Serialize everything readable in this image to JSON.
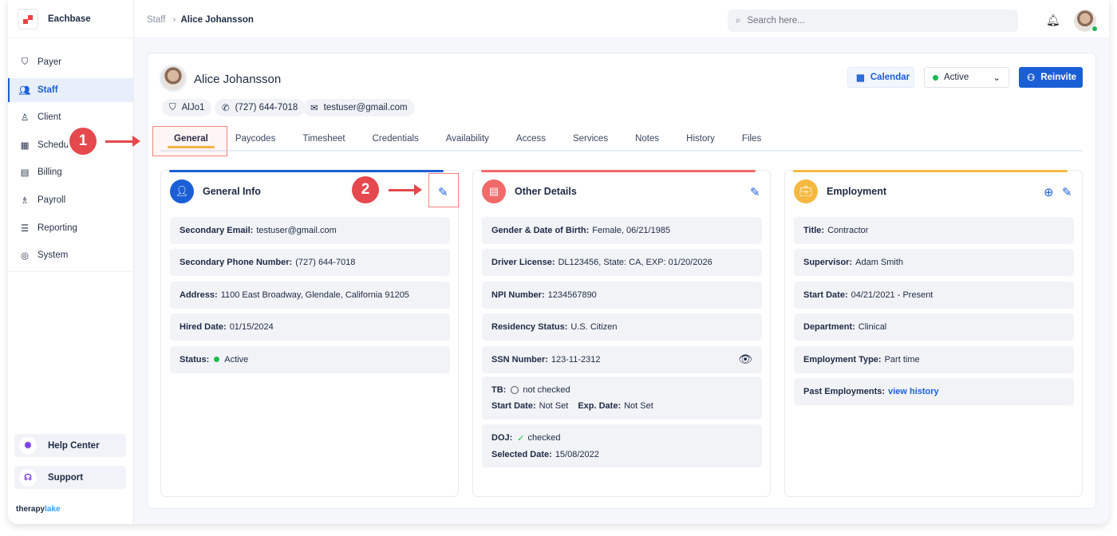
{
  "app": {
    "name": "Eachbase",
    "brand_left": "therapy",
    "brand_right": "lake"
  },
  "sidebar": {
    "items": [
      {
        "label": "Payer",
        "icon": "shield-icon"
      },
      {
        "label": "Staff",
        "icon": "users-icon",
        "active": true
      },
      {
        "label": "Client",
        "icon": "client-icon"
      },
      {
        "label": "Schedule",
        "icon": "calendar-icon"
      },
      {
        "label": "Billing",
        "icon": "billing-icon"
      },
      {
        "label": "Payroll",
        "icon": "payroll-icon"
      },
      {
        "label": "Reporting",
        "icon": "report-icon"
      },
      {
        "label": "System",
        "icon": "system-icon"
      }
    ],
    "help": "Help Center",
    "support": "Support"
  },
  "header": {
    "breadcrumb": [
      "Staff",
      "Alice Johansson"
    ],
    "search_placeholder": "Search here..."
  },
  "profile": {
    "name": "Alice Johansson",
    "id": "AlJo1",
    "phone": "(727) 644-7018",
    "email": "testuser@gmail.com",
    "calendar_label": "Calendar",
    "status": "Active",
    "reinvite_label": "Reinvite"
  },
  "tabs": [
    "General",
    "Paycodes",
    "Timesheet",
    "Credentials",
    "Availability",
    "Access",
    "Services",
    "Notes",
    "History",
    "Files"
  ],
  "general": {
    "title": "General Info",
    "rows": [
      {
        "k": "Secondary Email:",
        "v": "testuser@gmail.com"
      },
      {
        "k": "Secondary Phone Number:",
        "v": "(727) 644-7018"
      },
      {
        "k": "Address:",
        "v": "1100 East Broadway, Glendale, California 91205"
      },
      {
        "k": "Hired Date:",
        "v": "01/15/2024"
      },
      {
        "k": "Status:",
        "v": "Active"
      }
    ]
  },
  "other": {
    "title": "Other Details",
    "rows": [
      {
        "k": "Gender & Date of Birth:",
        "v": "Female, 06/21/1985"
      },
      {
        "k": "Driver License:",
        "v": "DL123456, State: CA, EXP: 01/20/2026"
      },
      {
        "k": "NPI Number:",
        "v": "1234567890"
      },
      {
        "k": "Residency Status:",
        "v": "U.S. Citizen"
      },
      {
        "k": "SSN Number:",
        "v": "123-11-2312"
      }
    ],
    "tb": {
      "k": "TB:",
      "v": "not checked",
      "start_k": "Start Date:",
      "start_v": "Not Set",
      "exp_k": "Exp. Date:",
      "exp_v": "Not Set"
    },
    "doj": {
      "k": "DOJ:",
      "v": "checked",
      "date_k": "Selected Date:",
      "date_v": "15/08/2022"
    }
  },
  "employment": {
    "title": "Employment",
    "rows": [
      {
        "k": "Title:",
        "v": "Contractor"
      },
      {
        "k": "Supervisor:",
        "v": "Adam Smith"
      },
      {
        "k": "Start Date:",
        "v": "04/21/2021 - Present"
      },
      {
        "k": "Department:",
        "v": "Clinical"
      },
      {
        "k": "Employment Type:",
        "v": "Part time"
      },
      {
        "k": "Past Employments:",
        "v": "view history"
      }
    ]
  },
  "annotations": [
    "1",
    "2"
  ],
  "colors": {
    "accent": "#1b5fd6",
    "active": "#1db954",
    "general_bar": "#1b5fd6",
    "other_bar": "#f06a6a",
    "employment_bar": "#f5b942",
    "annotation": "#e5484d"
  }
}
